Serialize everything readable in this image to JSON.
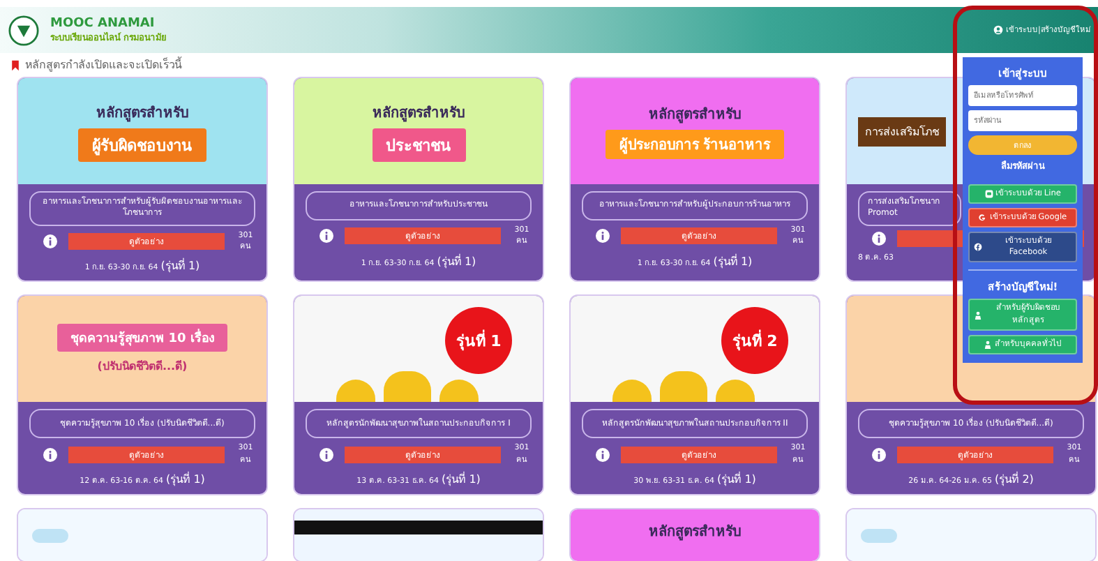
{
  "header": {
    "title": "MOOC ANAMAI",
    "subtitle": "ระบบเรียนออนไลน์ กรมอนามัย",
    "account_link": "เข้าระบบ|สร้างบัญชีใหม่"
  },
  "section_title": "หลักสูตรกำลังเปิดและจะเปิดเร็วนี้",
  "courses": [
    {
      "kind": "worker",
      "art_text": [
        {
          "kind": "heading",
          "text": "หลักสูตรสำหรับ"
        },
        {
          "kind": "ribbon",
          "text": "ผู้รับผิดชอบงาน"
        }
      ],
      "title": "อาหารและโภชนาการสำหรับผู้รับผิดชอบงานอาหารและโภชนาการ",
      "button": "ดูตัวอย่าง",
      "count": "301 คน",
      "date": "1 ก.ย. 63-30 ก.ย. 64",
      "cohort": "(รุ่นที่ 1)"
    },
    {
      "kind": "people",
      "art_text": [
        {
          "kind": "heading",
          "text": "หลักสูตรสำหรับ"
        },
        {
          "kind": "ribbon",
          "text": "ประชาชน"
        }
      ],
      "title": "อาหารและโภชนาการสำหรับประชาชน",
      "button": "ดูตัวอย่าง",
      "count": "301 คน",
      "date": "1 ก.ย. 63-30 ก.ย. 64",
      "cohort": "(รุ่นที่ 1)"
    },
    {
      "kind": "chef",
      "art_text": [
        {
          "kind": "heading",
          "text": "หลักสูตรสำหรับ"
        },
        {
          "kind": "ribbon",
          "text": "ผู้ประกอบการ ร้านอาหาร"
        }
      ],
      "title": "อาหารและโภชนาการสำหรับผู้ประกอบการร้านอาหาร",
      "button": "ดูตัวอย่าง",
      "count": "301 คน",
      "date": "1 ก.ย. 63-30 ก.ย. 64",
      "cohort": "(รุ่นที่ 1)"
    },
    {
      "kind": "promo",
      "art_text": [
        {
          "kind": "label",
          "text": "การส่งเสริมโภช"
        }
      ],
      "title": "การส่งเสริมโภชนาก Promot",
      "date": "8 ต.ค. 63"
    },
    {
      "kind": "health",
      "art_text": [
        {
          "kind": "ribbon",
          "text": "ชุดความรู้สุขภาพ 10 เรื่อง"
        },
        {
          "kind": "heading",
          "text": "(ปรับนิดชีวิตดี...ดี)"
        }
      ],
      "title": "ชุดความรู้สุขภาพ 10 เรื่อง (ปรับนิดชีวิตดี...ดี)",
      "button": "ดูตัวอย่าง",
      "count": "301 คน",
      "date": "12 ต.ค. 63-16 ต.ค. 64",
      "cohort": "(รุ่นที่ 1)"
    },
    {
      "kind": "cohort",
      "art_text": [
        {
          "kind": "badge",
          "text": "รุ่นที่ 1"
        }
      ],
      "title": "หลักสูตรนักพัฒนาสุขภาพในสถานประกอบกิจการ I",
      "button": "ดูตัวอย่าง",
      "count": "301 คน",
      "date": "13 ต.ค. 63-31 ธ.ค. 64",
      "cohort": "(รุ่นที่ 1)"
    },
    {
      "kind": "cohort",
      "art_text": [
        {
          "kind": "badge",
          "text": "รุ่นที่ 2"
        }
      ],
      "title": "หลักสูตรนักพัฒนาสุขภาพในสถานประกอบกิจการ II",
      "button": "ดูตัวอย่าง",
      "count": "301 คน",
      "date": "30 พ.ย. 63-31 ธ.ค. 64",
      "cohort": "(รุ่นที่ 1)"
    },
    {
      "kind": "health",
      "title": "ชุดความรู้สุขภาพ 10 เรื่อง (ปรับนิดชีวิตดี...ดี)",
      "button": "ดูตัวอย่าง",
      "count": "301 คน",
      "date": "26 ม.ค. 64-26 ม.ค. 65",
      "cohort": "(รุ่นที่ 2)"
    },
    {
      "kind": "manual"
    },
    {
      "kind": "dspm"
    },
    {
      "kind": "chef",
      "art_text": [
        {
          "kind": "heading",
          "text": "หลักสูตรสำหรับ"
        }
      ]
    },
    {
      "kind": "manual"
    }
  ],
  "login_panel": {
    "title": "เข้าสู่ระบบ",
    "email_placeholder": "อีเมลหรือโทรศัพท์",
    "password_placeholder": "รหัสผ่าน",
    "submit": "ตกลง",
    "forgot": "ลืมรหัสผ่าน",
    "social": [
      {
        "kind": "line",
        "label": "เข้าระบบด้วย Line"
      },
      {
        "kind": "google",
        "label": "เข้าระบบด้วย Google"
      },
      {
        "kind": "facebook",
        "label": "เข้าระบบด้วย Facebook"
      }
    ],
    "register_title": "สร้างบัญชีใหม่!",
    "register": [
      {
        "label": "สำหรับผู้รับผิดชอบหลักสูตร"
      },
      {
        "label": "สำหรับบุคคลทั่วไป"
      }
    ]
  }
}
